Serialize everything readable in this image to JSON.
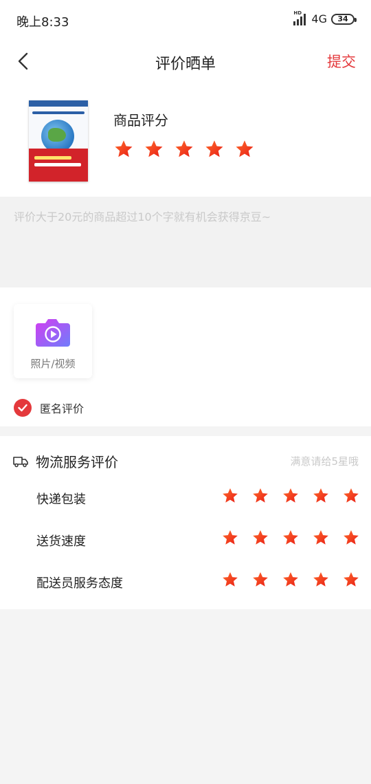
{
  "status_bar": {
    "time": "晚上8:33",
    "network": "4G",
    "battery": "34"
  },
  "header": {
    "title": "评价晒单",
    "submit_label": "提交"
  },
  "product": {
    "rating_label": "商品评分",
    "rating": 5,
    "max_rating": 5
  },
  "review": {
    "placeholder": "评价大于20元的商品超过10个字就有机会获得京豆~"
  },
  "media": {
    "upload_label": "照片/视频",
    "anonymous_label": "匿名评价",
    "anonymous_checked": true
  },
  "logistics": {
    "title": "物流服务评价",
    "hint": "满意请给5星哦",
    "rows": [
      {
        "label": "快递包装",
        "rating": 5
      },
      {
        "label": "送货速度",
        "rating": 5
      },
      {
        "label": "配送员服务态度",
        "rating": 5
      }
    ]
  },
  "colors": {
    "accent": "#e4393c",
    "star_gradient": [
      "#ff6a2a",
      "#e81e17"
    ]
  }
}
